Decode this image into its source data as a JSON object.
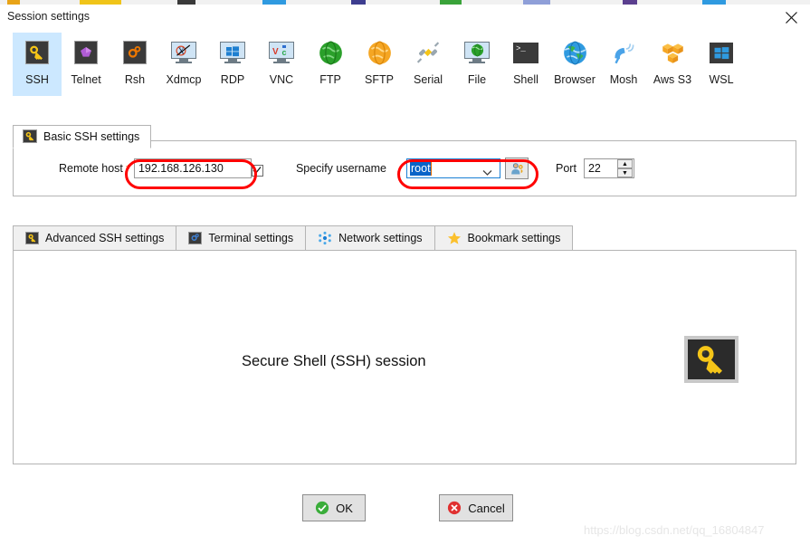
{
  "window": {
    "title": "Session settings",
    "close_icon": "close-icon"
  },
  "taskbar": {
    "segments": [
      "#e8a317",
      "#f0c419",
      "#3a3a3a",
      "#2f9ae0",
      "#3d3d8f",
      "#3aa33a",
      "#8f8fd0",
      "#5b3f8f",
      "#2f9ae0"
    ]
  },
  "protocols": [
    {
      "id": "ssh",
      "label": "SSH",
      "icon": "ssh-key-icon",
      "selected": true
    },
    {
      "id": "telnet",
      "label": "Telnet",
      "icon": "telnet-icon",
      "selected": false
    },
    {
      "id": "rsh",
      "label": "Rsh",
      "icon": "rsh-gears-icon",
      "selected": false
    },
    {
      "id": "xdmcp",
      "label": "Xdmcp",
      "icon": "xdmcp-icon",
      "selected": false
    },
    {
      "id": "rdp",
      "label": "RDP",
      "icon": "rdp-windows-icon",
      "selected": false
    },
    {
      "id": "vnc",
      "label": "VNC",
      "icon": "vnc-icon",
      "selected": false
    },
    {
      "id": "ftp",
      "label": "FTP",
      "icon": "ftp-globe-icon",
      "selected": false
    },
    {
      "id": "sftp",
      "label": "SFTP",
      "icon": "sftp-globe-icon",
      "selected": false
    },
    {
      "id": "serial",
      "label": "Serial",
      "icon": "serial-plug-icon",
      "selected": false
    },
    {
      "id": "file",
      "label": "File",
      "icon": "file-monitor-icon",
      "selected": false
    },
    {
      "id": "shell",
      "label": "Shell",
      "icon": "shell-prompt-icon",
      "selected": false
    },
    {
      "id": "browser",
      "label": "Browser",
      "icon": "browser-globe-icon",
      "selected": false
    },
    {
      "id": "mosh",
      "label": "Mosh",
      "icon": "mosh-dish-icon",
      "selected": false
    },
    {
      "id": "awss3",
      "label": "Aws S3",
      "icon": "aws-s3-cubes-icon",
      "selected": false
    },
    {
      "id": "wsl",
      "label": "WSL",
      "icon": "wsl-windows-icon",
      "selected": false
    }
  ],
  "basic_group": {
    "tab_label": "Basic SSH settings",
    "tab_icon": "ssh-key-icon",
    "remote_host_label": "Remote host",
    "required_marker": "*",
    "remote_host_value": "192.168.126.130",
    "specify_username_label": "Specify username",
    "specify_username_checked": true,
    "username_value": "root",
    "username_dropdown_icon": "chevron-down-icon",
    "user_picker_icon": "user-picker-icon",
    "port_label": "Port",
    "port_value": "22",
    "spinner_up_icon": "spinner-up-icon",
    "spinner_down_icon": "spinner-down-icon"
  },
  "settings_tabs": [
    {
      "id": "advanced-ssh",
      "label": "Advanced SSH settings",
      "icon": "ssh-key-icon"
    },
    {
      "id": "terminal",
      "label": "Terminal settings",
      "icon": "terminal-gear-icon"
    },
    {
      "id": "network",
      "label": "Network settings",
      "icon": "network-nodes-icon"
    },
    {
      "id": "bookmark",
      "label": "Bookmark settings",
      "icon": "star-icon"
    }
  ],
  "panel": {
    "caption": "Secure Shell (SSH) session",
    "big_icon": "ssh-key-icon"
  },
  "buttons": {
    "ok_label": "OK",
    "ok_icon": "check-circle-icon",
    "cancel_label": "Cancel",
    "cancel_icon": "x-circle-icon"
  },
  "watermark": "https://blog.csdn.net/qq_16804847",
  "colors": {
    "selection_blue": "#cce8ff",
    "text_selection": "#0a64c8",
    "annotation_red": "#ff0000",
    "required_orange": "#e8710a",
    "key_gold": "#f5c518",
    "ok_green": "#3aad3a",
    "cancel_red": "#e03131"
  }
}
